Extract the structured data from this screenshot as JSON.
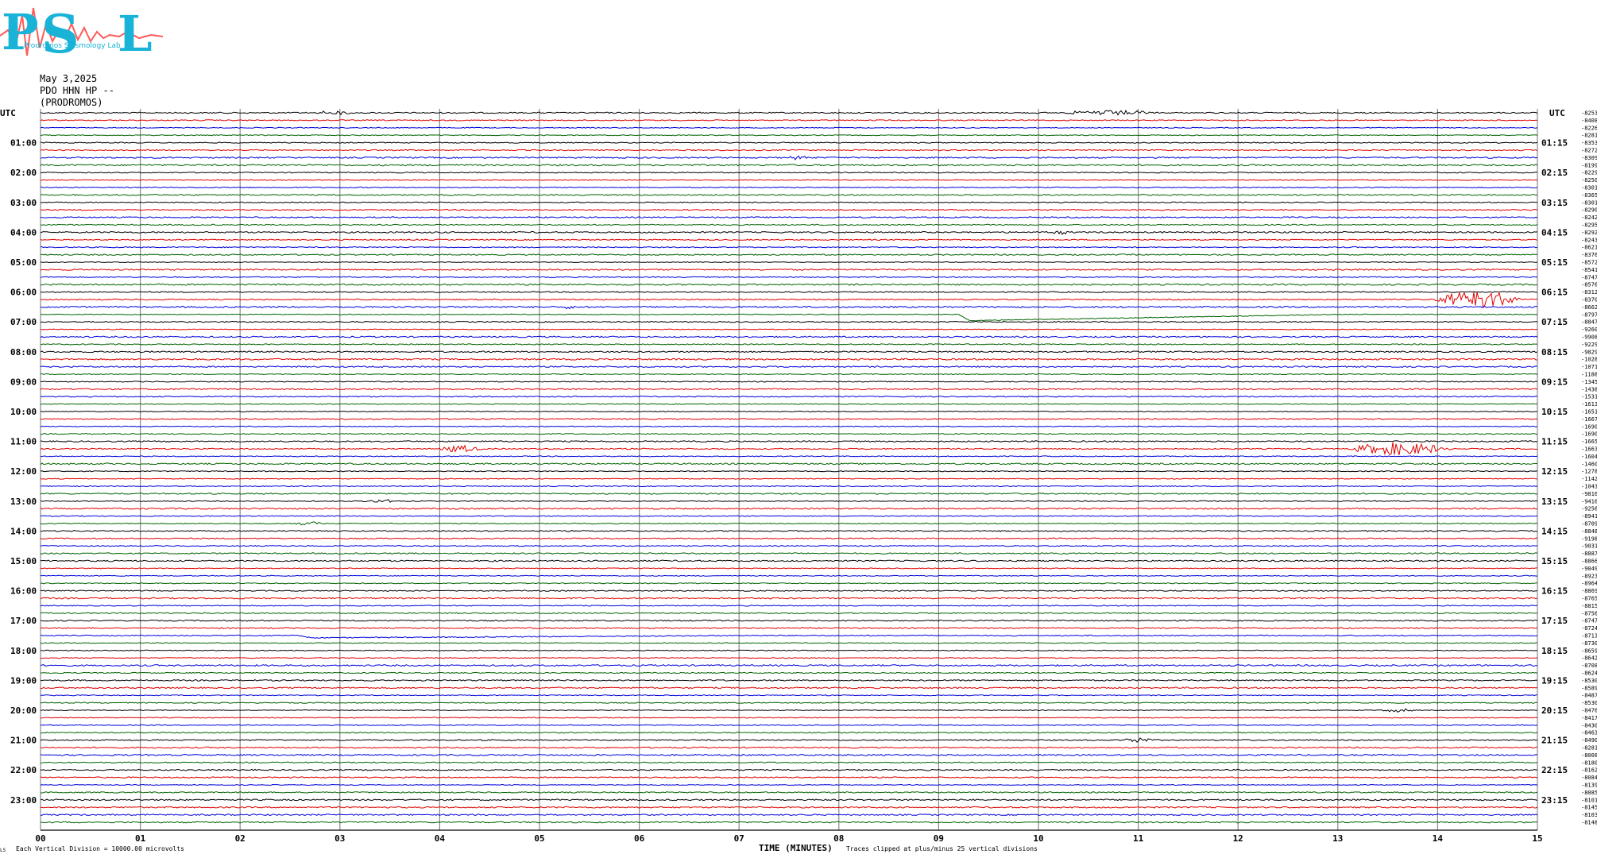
{
  "header": {
    "logo_letters": "PSL",
    "logo_text": "Prodromos Seismology Lab",
    "date": "May 3,2025",
    "station": "PDO HHN HP --",
    "location": "(PRODROMOS)"
  },
  "footer": {
    "scale_note": "Each Vertical Division = 10000.00 microvolts",
    "clip_note": "Traces clipped at plus/minus 25 vertical divisions",
    "corner_mark": "LS"
  },
  "colors": {
    "black": "#000000",
    "red": "#e00000",
    "blue": "#0000dd",
    "green": "#006400",
    "grid": "#888888"
  },
  "chart_data": {
    "type": "line",
    "title": "",
    "xlabel": "TIME (MINUTES)",
    "ylabel": "",
    "left_axis_title": "UTC",
    "right_axis_title": "UTC",
    "xlim": [
      0,
      15
    ],
    "x_ticks": [
      "00",
      "01",
      "02",
      "03",
      "04",
      "05",
      "06",
      "07",
      "08",
      "09",
      "10",
      "11",
      "12",
      "13",
      "14",
      "15"
    ],
    "trace_minutes": 15,
    "trace_color_cycle": [
      "black",
      "red",
      "blue",
      "green"
    ],
    "left_hour_labels": [
      "01:00",
      "02:00",
      "03:00",
      "04:00",
      "05:00",
      "06:00",
      "07:00",
      "08:00",
      "09:00",
      "10:00",
      "11:00",
      "12:00",
      "13:00",
      "14:00",
      "15:00",
      "16:00",
      "17:00",
      "18:00",
      "19:00",
      "20:00",
      "21:00",
      "22:00",
      "23:00"
    ],
    "right_hour_labels": [
      "01:15",
      "02:15",
      "03:15",
      "04:15",
      "05:15",
      "06:15",
      "07:15",
      "08:15",
      "09:15",
      "10:15",
      "11:15",
      "12:15",
      "13:15",
      "14:15",
      "15:15",
      "16:15",
      "17:15",
      "18:15",
      "19:15",
      "20:15",
      "21:15",
      "22:15",
      "23:15"
    ],
    "trace_offsets": [
      "-8253",
      "-8408",
      "-8226",
      "-8281",
      "-8353",
      "-8272",
      "-8309",
      "-8199",
      "-8229",
      "-8250",
      "-8301",
      "-8365",
      "-8301",
      "-8290",
      "-8242",
      "-8295",
      "-8292",
      "-8243",
      "-8621",
      "-8376",
      "-8572",
      "-8541",
      "-8747",
      "-8576",
      "-8312",
      "-8370",
      "-8662",
      "-8797",
      "-8847",
      "-9260",
      "-9908",
      "-9229",
      "-9829",
      "-10281",
      "-10718",
      "-11881",
      "-13452",
      "-14388",
      "-15311",
      "-16137",
      "-16512",
      "-16677",
      "-16909",
      "-16903",
      "-16656",
      "-16634",
      "-16041",
      "-14600",
      "-12785",
      "-11425",
      "-10431",
      "-9816",
      "-9416",
      "-9256",
      "-8941",
      "-8709",
      "-8848",
      "-9198",
      "-9031",
      "-8887",
      "-8866",
      "-9049",
      "-8923",
      "-8964",
      "-8869",
      "-8765",
      "-8815",
      "-8756",
      "-8747",
      "-8724",
      "-8713",
      "-8730",
      "-8659",
      "-8642",
      "-8708",
      "-8624",
      "-8530",
      "-8589",
      "-8487",
      "-8530",
      "-8476",
      "-8417",
      "-8430",
      "-8463",
      "-8490",
      "-8281",
      "-8008",
      "-8180",
      "-8162",
      "-8084",
      "-8139",
      "-8085",
      "-8101",
      "-8145",
      "-8103",
      "-8148"
    ],
    "events": [
      {
        "trace": 0,
        "minute": 2.9,
        "amplitude": 2,
        "duration_min": 0.6
      },
      {
        "trace": 0,
        "minute": 10.7,
        "amplitude": 3,
        "duration_min": 1.0
      },
      {
        "trace": 6,
        "minute": 7.6,
        "amplitude": 2,
        "duration_min": 0.3
      },
      {
        "trace": 16,
        "minute": 10.2,
        "amplitude": 2,
        "duration_min": 0.3
      },
      {
        "trace": 26,
        "minute": 5.3,
        "amplitude": 3,
        "duration_min": 0.2
      },
      {
        "trace": 25,
        "minute": 14.4,
        "amplitude": 12,
        "duration_min": 0.9
      },
      {
        "trace": 45,
        "minute": 4.2,
        "amplitude": 4,
        "duration_min": 0.5
      },
      {
        "trace": 45,
        "minute": 13.6,
        "amplitude": 8,
        "duration_min": 1.1
      },
      {
        "trace": 52,
        "minute": 3.4,
        "amplitude": 2,
        "duration_min": 0.4
      },
      {
        "trace": 55,
        "minute": 2.7,
        "amplitude": 2,
        "duration_min": 0.4
      },
      {
        "trace": 80,
        "minute": 13.6,
        "amplitude": 2,
        "duration_min": 0.4
      },
      {
        "trace": 84,
        "minute": 11.0,
        "amplitude": 3,
        "duration_min": 0.4
      }
    ],
    "drifts": [
      {
        "trace": 27,
        "start_minute": 9.2,
        "end_minute": 13.0,
        "depth": 8
      },
      {
        "trace": 70,
        "start_minute": 2.6,
        "end_minute": 7.0,
        "depth": 3
      }
    ]
  }
}
